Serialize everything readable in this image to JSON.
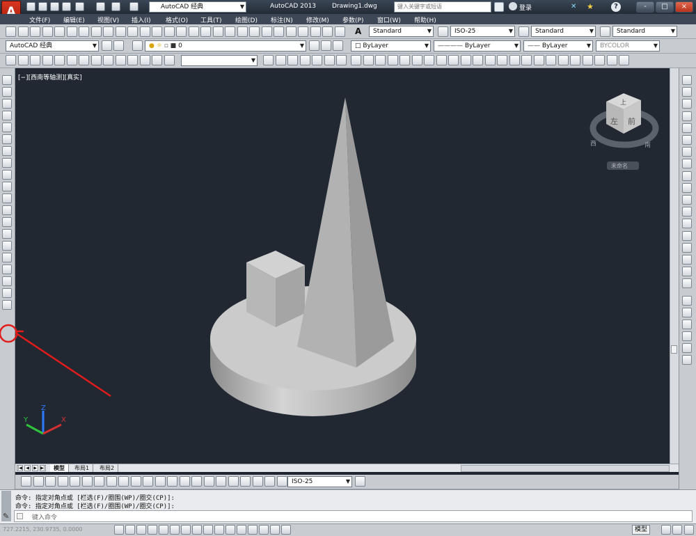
{
  "app": {
    "logo": "A",
    "title": "AutoCAD 2013",
    "file": "Drawing1.dwg",
    "workspace": "AutoCAD 经典"
  },
  "search": {
    "placeholder": "键入关键字或短语"
  },
  "user": {
    "login": "登录"
  },
  "window_controls": [
    "-",
    "□",
    "×"
  ],
  "menu": [
    "文件(F)",
    "编辑(E)",
    "视图(V)",
    "插入(I)",
    "格式(O)",
    "工具(T)",
    "绘图(D)",
    "标注(N)",
    "修改(M)",
    "参数(P)",
    "窗口(W)",
    "帮助(H)"
  ],
  "styles": {
    "text_style": "Standard",
    "dim_style": "ISO-25",
    "table_style": "Standard",
    "multileader_style": "Standard"
  },
  "layers": {
    "workspace": "AutoCAD 经典",
    "current_layer": "0"
  },
  "properties": {
    "color": "ByLayer",
    "linetype": "ByLayer",
    "lineweight": "ByLayer",
    "plot_style": "BYCOLOR"
  },
  "viewport": {
    "label": "[−][西南等轴测][真实]"
  },
  "viewcube": {
    "top": "上",
    "front": "前",
    "left": "左",
    "compass_west": "西",
    "compass_south": "南",
    "wcs": "未命名"
  },
  "ucs": {
    "x": "X",
    "y": "Y",
    "z": "Z"
  },
  "layout_tabs": [
    "模型",
    "布局1",
    "布局2"
  ],
  "dim_toolbar": {
    "dim_style": "ISO-25"
  },
  "command": {
    "history": [
      "命令: 指定对角点或 [栏选(F)/圈围(WP)/圈交(CP)]:",
      "命令: 指定对角点或 [栏选(F)/圈围(WP)/圈交(CP)]:"
    ],
    "placeholder": "键入命令"
  },
  "status": {
    "coords": "727.2215, 230.9735, 0.0000",
    "model": "模型"
  },
  "colors": {
    "annotation": "#e21b1b",
    "drawing_bg": "#212832",
    "solid": "#b9b9b9"
  }
}
